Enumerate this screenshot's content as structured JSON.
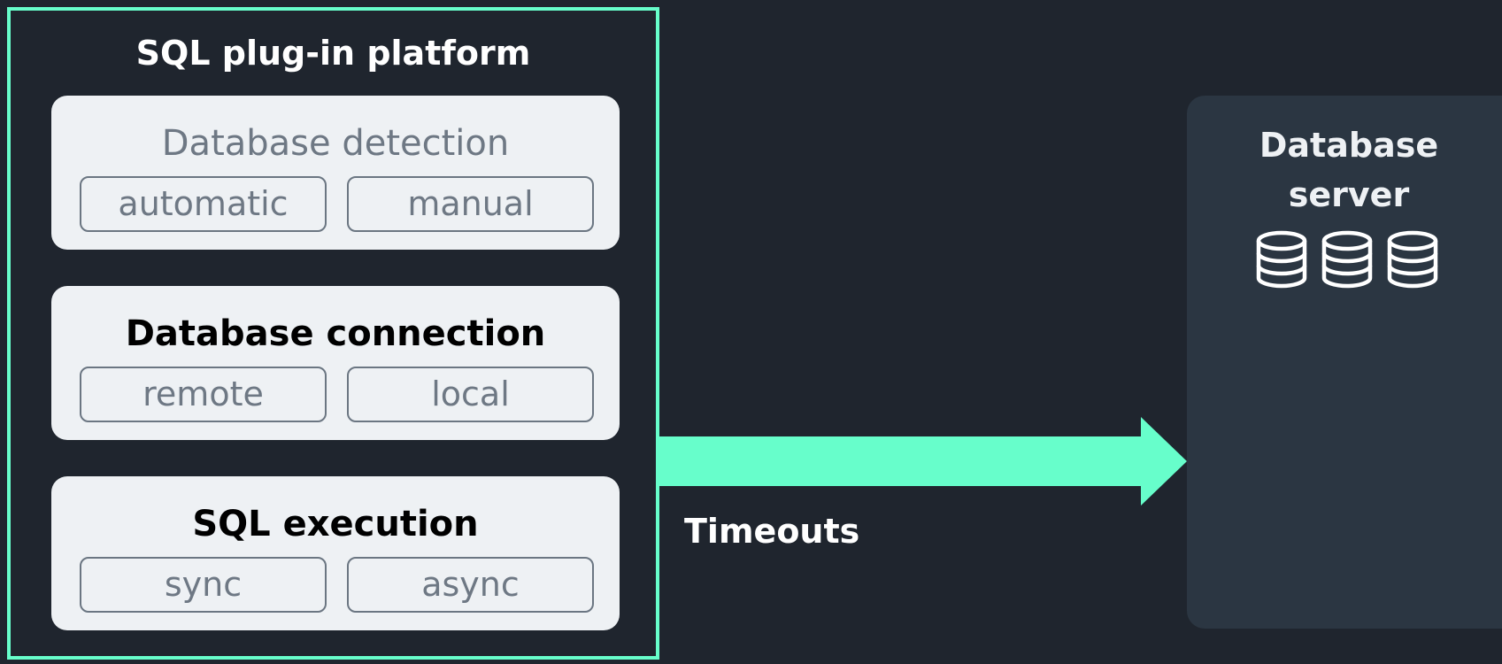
{
  "platform": {
    "title": "SQL plug-in platform",
    "sections": [
      {
        "title": "Database detection",
        "options": [
          "automatic",
          "manual"
        ]
      },
      {
        "title": "Database connection",
        "options": [
          "remote",
          "local"
        ]
      },
      {
        "title": "SQL execution",
        "options": [
          "sync",
          "async"
        ]
      }
    ]
  },
  "arrow": {
    "label": "Timeouts"
  },
  "server": {
    "title_line1": "Database",
    "title_line2": "server",
    "icons": [
      "database-icon",
      "database-icon",
      "database-icon"
    ]
  },
  "colors": {
    "background": "#1f252e",
    "accent": "#67fecb",
    "card": "#eef1f4",
    "server_panel": "#2b3642",
    "muted_text": "#6e7884"
  }
}
